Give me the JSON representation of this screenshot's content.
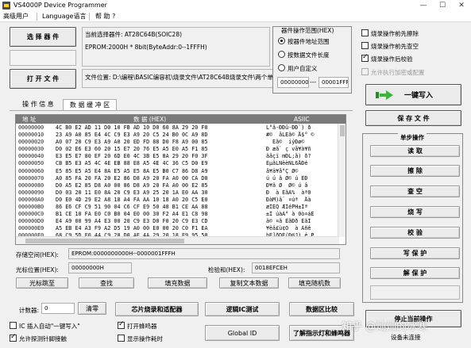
{
  "window": {
    "title": "VS4000P  Device  Programmer",
    "controls": {
      "minimize": "—",
      "maximize": "☐",
      "close": "✕"
    }
  },
  "menu": {
    "items": [
      "高级用户",
      "Language语言",
      "帮 助 ?"
    ]
  },
  "left_buttons": {
    "select_device": "选 择 器 件",
    "open_file": "打 开 文 件"
  },
  "device_info": {
    "current_device": "当前选择器件:    AT28C64B(SOIC28)",
    "eprom": "EPROM:2000H * 8bit(ByteAddr:0--1FFFH)",
    "file_location": "文件位置:  D:\\编程\\BASIC编容机\\烧录文件\\AT28C64B烧录文件\\两个单"
  },
  "range_group": {
    "title": "器件操作范围(HEX)",
    "options": [
      "按器件地址范围",
      "按数据文件长度",
      "用户自定义"
    ],
    "selected": 0,
    "start": "00000000",
    "end": "00001FFF",
    "sep": "---"
  },
  "options": {
    "items": [
      {
        "label": "烧录操作前先擦除",
        "checked": false
      },
      {
        "label": "烧录操作前先查空",
        "checked": false
      },
      {
        "label": "烧录操作后校验",
        "checked": true
      },
      {
        "label": "允许执行加密或配置",
        "checked": false,
        "disabled": true
      }
    ]
  },
  "actions": {
    "burn": "一键写入",
    "save_file": "保 存 文 件",
    "step_ops_title": "单步操作",
    "steps": [
      "读   取",
      "擦   除",
      "查   空",
      "烧   写",
      "校   验",
      "写 保 护",
      "解 保 护"
    ],
    "stop": "停止当前操作"
  },
  "tabs": [
    "操 作 信 息",
    "数 据 缓 冲 区"
  ],
  "active_tab": 1,
  "grid": {
    "headers": {
      "addr": "地 址",
      "hex": "数 据 (HEX)",
      "ascii": "ASIIC"
    },
    "rows": [
      {
        "addr": "00000000",
        "hex": "4C B0 E2 AD 11 D0 10 FB AD 10 D0 60 8A 29 20 F0",
        "ascii": "L°â-ÐÐû-ÐÐ`) ð"
      },
      {
        "addr": "00000010",
        "hex": "23 A9 A0 85 E4 4C C9 E3 A9 20 C5 24 B0 0C A9 8D",
        "ascii": "#©  åLÉã© Å$° ©"
      },
      {
        "addr": "00000020",
        "hex": "A0 07 20 C9 E3 A9 A0 20 ED FD 88 D0 F8 A9 00 85",
        "ascii": "  Éã©  íýÐø© "
      },
      {
        "addr": "00000030",
        "hex": "D0 02 E6 E3 60 20 15 E7 20 76 E5 A5 E0 A5 F1 85",
        "ascii": "Ð æã` ç vå¥à¥ñ"
      },
      {
        "addr": "00000040",
        "hex": "E3 E5 E7 80 EF 20 6D E0 4C 3B E5 8A 29 20 F0 3F",
        "ascii": "ãåçï mÐL;å) ð?"
      },
      {
        "addr": "00000050",
        "hex": "CB B5 E3 A5 4C 4E EB 88 E8 A5 4E 4C 36 C5 D0 E9",
        "ascii": "ËµãLNëèNL6ÅÐé"
      },
      {
        "addr": "00000060",
        "hex": "E5 85 E5 A5 E4 8A E5 A5 E5 8A E5 B0 C7 86 D8 A9",
        "ascii": "å¥ä¥å°Ç Ø©"
      },
      {
        "addr": "00000070",
        "hex": "A0 85 FA 20 FA 20 E2 86 D8 A9 20 FA A0 00 CA D0",
        "ascii": "ú ú â Ø© ú ÊÐ"
      },
      {
        "addr": "00000080",
        "hex": "D0 A5 E2 85 D8 A0 00 86 D8 A9 20 FA A0 00 E2 85",
        "ascii": "Ð¥â Ø  Ø© ú â"
      },
      {
        "addr": "00000090",
        "hex": "D0 03 20 11 E0 8A 20 C9 E3 A9 25 20 1A E0 AA 30",
        "ascii": "Ð  à ÉãÀ%  àª0"
      },
      {
        "addr": "000000A0",
        "hex": "D0 E0 4D 29 E2 A8 18 A4 FA AA 10 18 A0 20 C5 E0",
        "ascii": "ÐàM)â¨ ¤úª  Åà"
      },
      {
        "addr": "000000B0",
        "hex": "86 E6 CF C9 51 90 04 C6 CF E9 50 48 B1 CE AA 88",
        "ascii": "æÏÉQ ÆÏéPH±Îª"
      },
      {
        "addr": "000000C0",
        "hex": "B1 CE 10 FA E0 C0 B0 04 E0 00 30 F2 A4 E1 C8 98",
        "ascii": "±Î úàÀ° à 0ò¤áÈ"
      },
      {
        "addr": "000000D0",
        "hex": "E4 A9 00 99 A4 E3 00 20 C9 E3 D0 F0 20 C9 E3 CD",
        "ascii": "ä© ¤ã ÉãÐð ÉãÍ"
      },
      {
        "addr": "000000E0",
        "hex": "A5 EB E4 A3 F9 A2 D5 19 A0 00 E0 00 20 C0 F1 EA",
        "ascii": "¥ëä£ù¢Õ  à Àñê"
      },
      {
        "addr": "000000F0",
        "hex": "68 C9 5D F0 44 C9 28 D0 AE 4A 29 20 18 E9 95 50",
        "ascii": "hÉ]ðDÉ(Ð®J) é P"
      }
    ]
  },
  "info_fields": {
    "storage_label": "存储空间(HEX):",
    "storage_value": "EPROM:0000000000H--0000001FFFH",
    "cursor_label": "光标位置(HEX):",
    "cursor_value": "00000000H",
    "checksum_label": "检验和(HEX):",
    "checksum_value": "0018EFCEH"
  },
  "grid_buttons": [
    "光标跳至",
    "查找",
    "填充数据",
    "复制文本数据",
    "填充随机数"
  ],
  "bottom": {
    "counter_label": "计数器:",
    "counter_value": "0",
    "clear": "清零",
    "chip_config": "芯片烧录和适配器",
    "logic_test": "逻辑IC测试",
    "data_compare": "数据区比较",
    "global_id": "Global ID",
    "learn": "了解指示灯和蜂鸣器",
    "checks": [
      {
        "label": "IC 插入自动\"一键写入\"",
        "checked": false
      },
      {
        "label": "打开蜂鸣器",
        "checked": true
      },
      {
        "label": "允许探测针脚接触",
        "checked": true
      },
      {
        "label": "显示操作耗时",
        "checked": false
      }
    ],
    "device_link": "设备未连接"
  },
  "watermark": "知乎 @灿灿的冰寒"
}
